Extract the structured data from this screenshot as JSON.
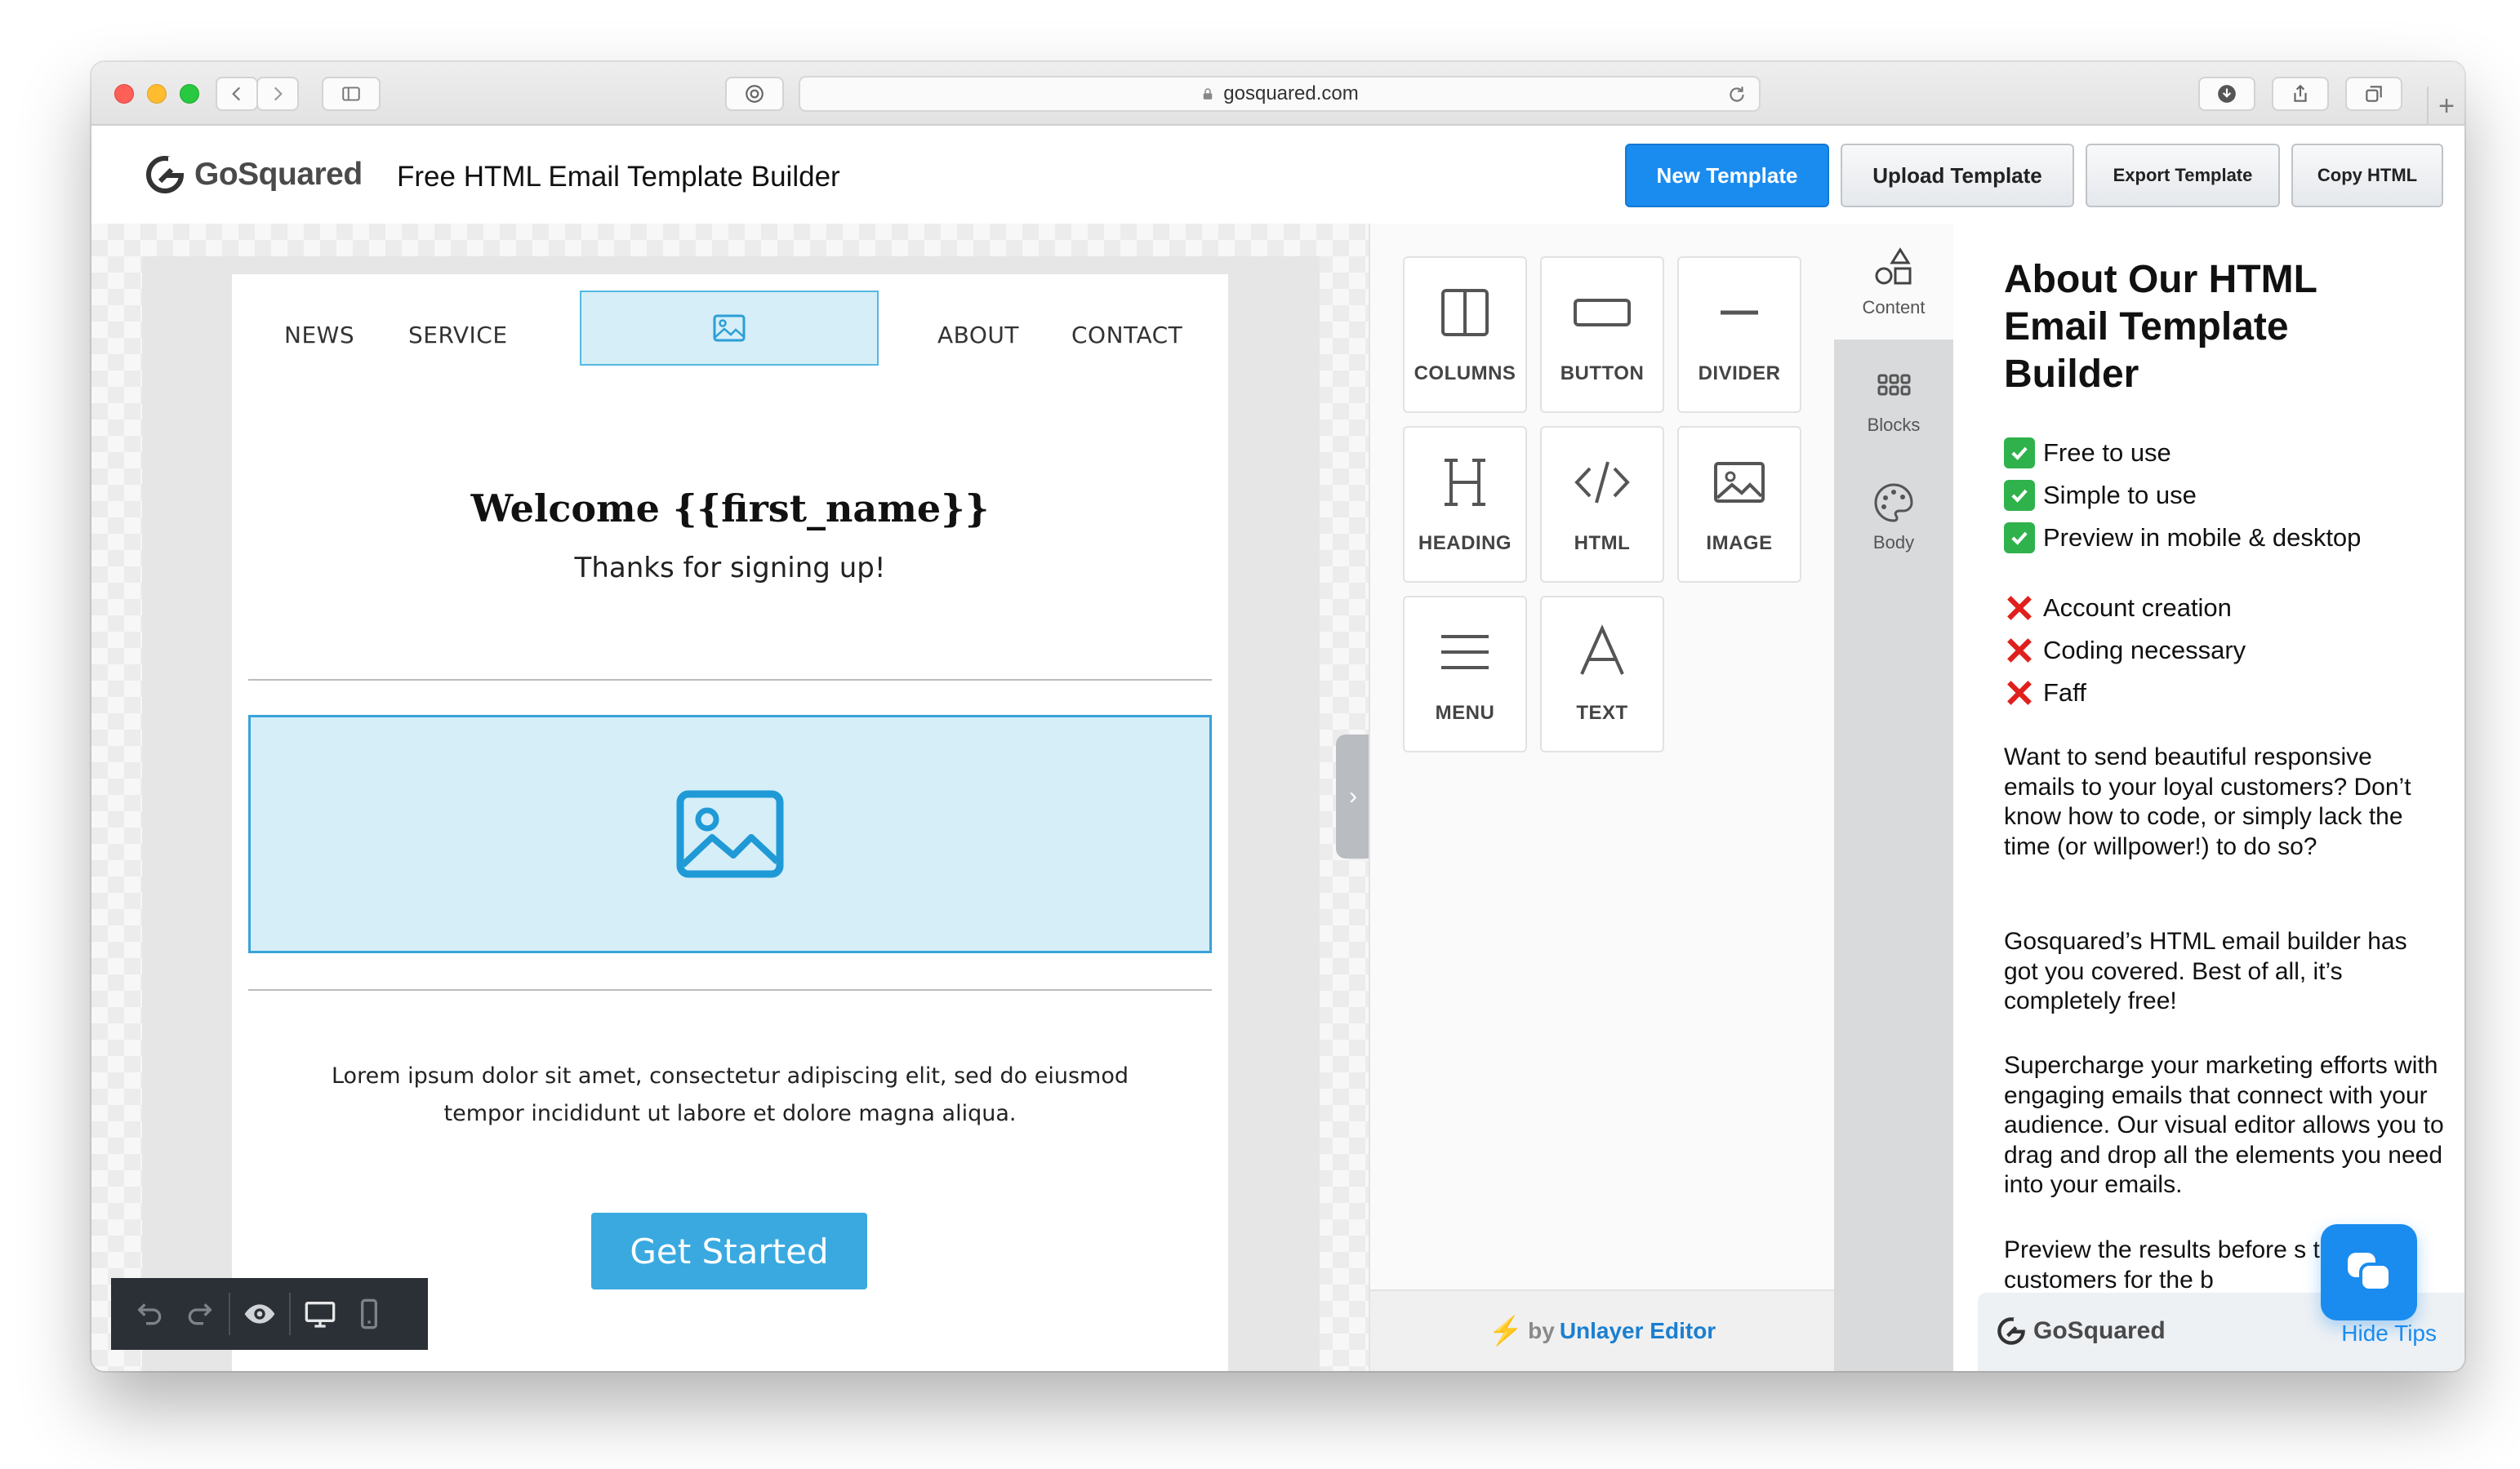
{
  "browser": {
    "url": "gosquared.com"
  },
  "header": {
    "logo_text": "GoSquared",
    "title": "Free HTML Email Template Builder",
    "buttons": {
      "new_template": "New Template",
      "upload_template": "Upload Template",
      "export_template": "Export Template",
      "copy_html": "Copy HTML"
    }
  },
  "email": {
    "nav": [
      "NEWS",
      "SERVICE",
      "ABOUT",
      "CONTACT"
    ],
    "welcome": "Welcome {{first_name}}",
    "thanks": "Thanks for signing up!",
    "lorem_line1": "Lorem ipsum dolor sit amet, consectetur adipiscing elit, sed do eiusmod",
    "lorem_line2": "tempor incididunt ut labore et dolore magna aliqua.",
    "cta": "Get Started"
  },
  "tools": {
    "tiles": [
      "COLUMNS",
      "BUTTON",
      "DIVIDER",
      "HEADING",
      "HTML",
      "IMAGE",
      "MENU",
      "TEXT"
    ],
    "brand_by": "by",
    "brand_name": "Unlayer Editor"
  },
  "side_tabs": [
    "Content",
    "Blocks",
    "Body"
  ],
  "tips": {
    "title": "About Our HTML Email Template Builder",
    "pros": [
      "Free to use",
      "Simple to use",
      "Preview in mobile & desktop"
    ],
    "cons": [
      "Account creation",
      "Coding necessary",
      "Faff"
    ],
    "para1": "Want to send beautiful responsive emails to your loyal customers? Don’t know how to code, or simply lack the time (or willpower!) to do so?",
    "para2": "Gosquared’s HTML email builder has got you covered. Best of all, it’s completely free!",
    "para3": "Supercharge your marketing efforts with engaging emails that connect with your audience. Our visual editor allows you to drag and drop all the elements you need into your emails.",
    "para4": "Preview the results before s to your customers for the b",
    "footer_logo": "GoSquared",
    "hide_tips": "Hide Tips"
  },
  "colors": {
    "primary": "#1a8cf0",
    "cta": "#3aa9e0",
    "image_placeholder": "#d6eef8"
  }
}
